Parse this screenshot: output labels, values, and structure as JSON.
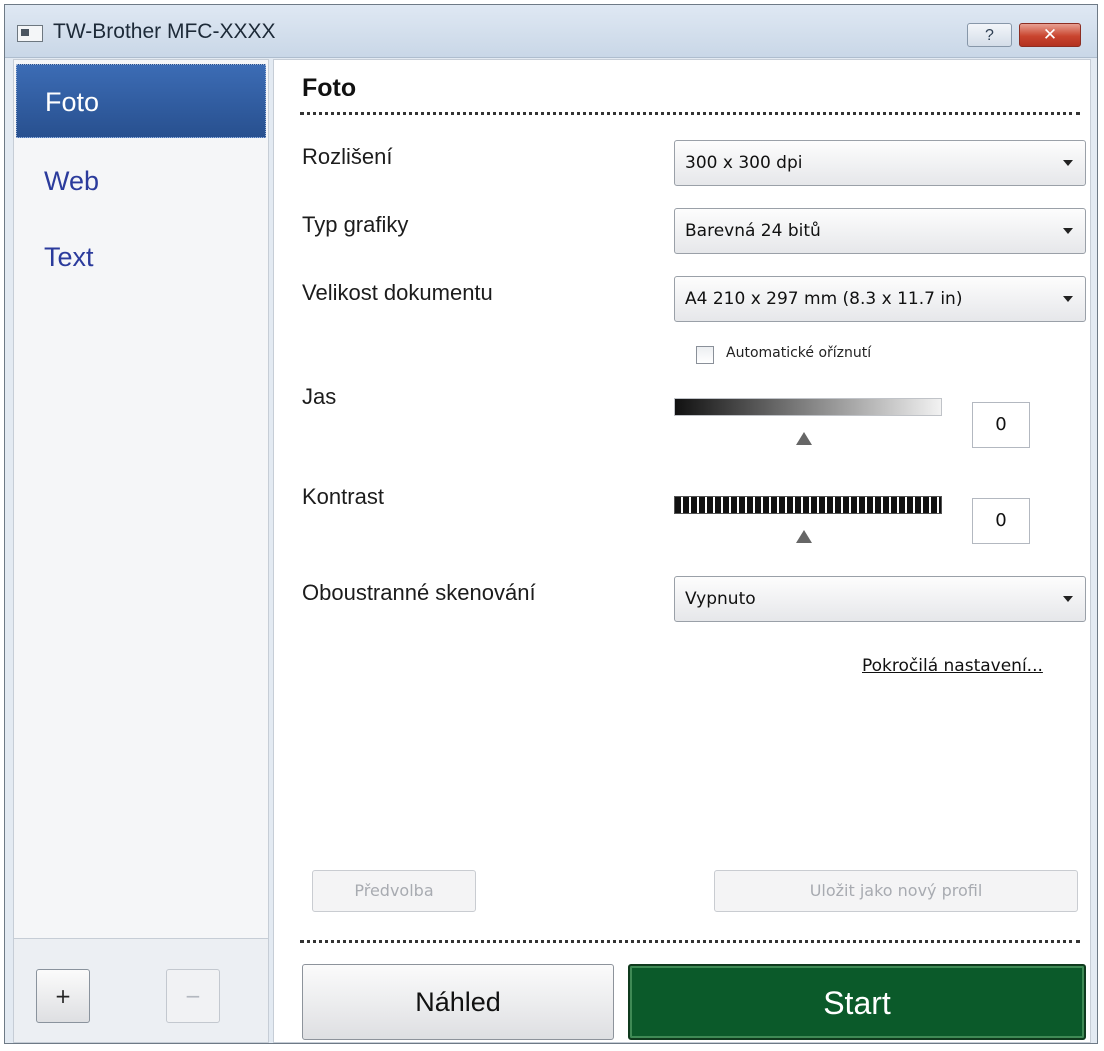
{
  "window": {
    "title": "TW-Brother  MFC-XXXX",
    "help_label": "?",
    "close_label": "✕"
  },
  "sidebar": {
    "items": [
      {
        "label": "Foto",
        "selected": true
      },
      {
        "label": "Web",
        "selected": false
      },
      {
        "label": "Text",
        "selected": false
      }
    ],
    "add_label": "+",
    "remove_label": "−"
  },
  "main": {
    "section_title": "Foto",
    "resolution": {
      "label": "Rozlišení",
      "value": "300 x 300 dpi"
    },
    "graphic_type": {
      "label": "Typ grafiky",
      "value": "Barevná 24 bitů"
    },
    "document_size": {
      "label": "Velikost dokumentu",
      "value": "A4 210 x 297 mm (8.3 x 11.7 in)"
    },
    "auto_crop": {
      "label": "Automatické oříznutí",
      "checked": false
    },
    "brightness": {
      "label": "Jas",
      "value": "0"
    },
    "contrast": {
      "label": "Kontrast",
      "value": "0"
    },
    "duplex": {
      "label": "Oboustranné skenování",
      "value": "Vypnuto"
    },
    "advanced_link": "Pokročilá nastavení...",
    "preset_label": "Předvolba",
    "save_profile_label": "Uložit jako nový profil",
    "preview_label": "Náhled",
    "start_label": "Start"
  },
  "colors": {
    "sidebar_selected": "#28508f",
    "sidebar_text": "#2b3b9c",
    "start_button": "#0b5a2a",
    "close_button": "#c9452f"
  }
}
